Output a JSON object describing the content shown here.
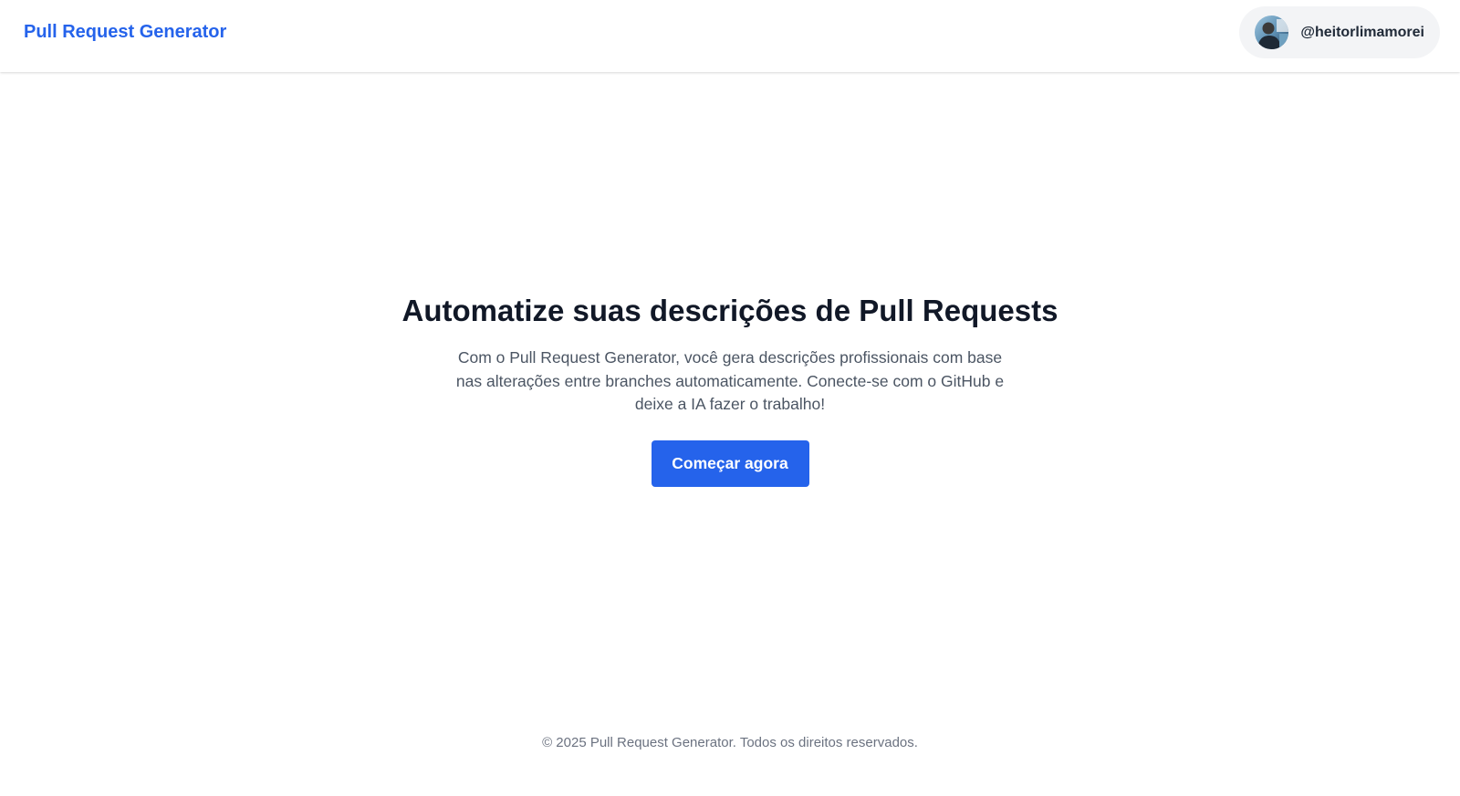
{
  "header": {
    "brand": "Pull Request Generator",
    "user": {
      "username": "@heitorlimamorei"
    }
  },
  "hero": {
    "title": "Automatize suas descrições de Pull Requests",
    "description": "Com o Pull Request Generator, você gera descrições profissionais com base nas alterações entre branches automaticamente. Conecte-se com o GitHub e deixe a IA fazer o trabalho!",
    "cta_label": "Começar agora"
  },
  "footer": {
    "copyright": "© 2025 Pull Request Generator. Todos os direitos reservados."
  },
  "colors": {
    "accent": "#2563eb",
    "heading": "#111827",
    "body_text": "#4b5563",
    "muted": "#6b7280",
    "chip_background": "#f3f4f6"
  }
}
